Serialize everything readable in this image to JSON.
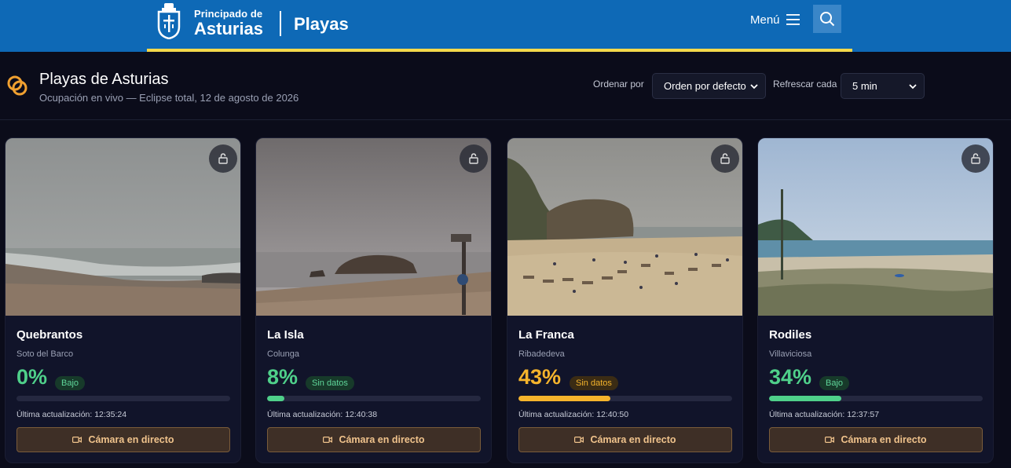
{
  "header": {
    "org_line1": "Principado de",
    "org_line2": "Asturias",
    "section": "Playas",
    "menu_label": "Menú",
    "brand_color": "#0e69b6",
    "accent_color": "#f4d84b"
  },
  "page": {
    "title": "Playas de Asturias",
    "subtitle": "Ocupación en vivo — Eclipse total, 12 de agosto de 2026",
    "sort_label": "Ordenar por",
    "sort_value": "Orden por defecto",
    "refresh_label": "Refrescar cada",
    "refresh_value": "5 min"
  },
  "beaches": [
    {
      "name": "Quebrantos",
      "town": "Soto del Barco",
      "occupancy": "0%",
      "occupancy_fraction": 0.0,
      "status": "Bajo",
      "color": "#4fd08a",
      "updated": "Última actualización: 12:35:24",
      "camera_label": "Cámara en directo",
      "lock_icon": "lock-icon"
    },
    {
      "name": "La Isla",
      "town": "Colunga",
      "occupancy": "8%",
      "occupancy_fraction": 0.08,
      "status": "Sin datos",
      "color": "#4fd08a",
      "updated": "Última actualización: 12:40:38",
      "camera_label": "Cámara en directo",
      "lock_icon": "lock-icon"
    },
    {
      "name": "La Franca",
      "town": "Ribadedeva",
      "occupancy": "43%",
      "occupancy_fraction": 0.43,
      "status": "Sin datos",
      "color": "#f5b42c",
      "updated": "Última actualización: 12:40:50",
      "camera_label": "Cámara en directo",
      "lock_icon": "lock-icon"
    },
    {
      "name": "Rodiles",
      "town": "Villaviciosa",
      "occupancy": "34%",
      "occupancy_fraction": 0.34,
      "status": "Bajo",
      "color": "#4fd08a",
      "updated": "Última actualización: 12:37:57",
      "camera_label": "Cámara en directo",
      "lock_icon": "lock-icon"
    }
  ]
}
